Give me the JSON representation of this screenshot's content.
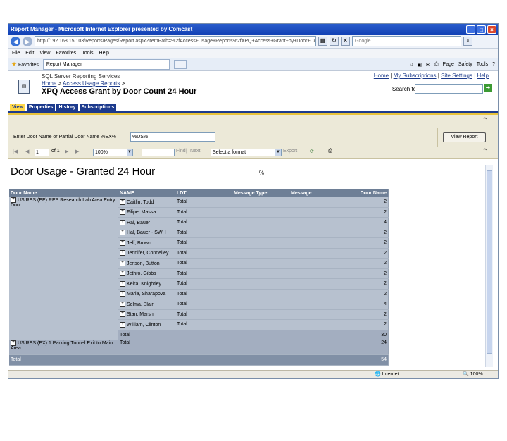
{
  "window": {
    "title": "Report Manager - Microsoft Internet Explorer presented by Comcast",
    "address": "http://192.168.15.103/Reports/Pages/Report.aspx?ItemPath=%2fAccess+Usage+Reports%2fXPQ+Access+Grant+by+Door+Cou",
    "search_placeholder": "Google",
    "menu": [
      "File",
      "Edit",
      "View",
      "Favorites",
      "Tools",
      "Help"
    ],
    "favorites_label": "Favorites",
    "tab_label": "Report Manager",
    "tools": [
      "Page",
      "Safety",
      "Tools"
    ]
  },
  "ssrs": {
    "name": "SQL Server Reporting Services",
    "breadcrumb_home": "Home",
    "breadcrumb_sep": ">",
    "breadcrumb_folder": "Access Usage Reports",
    "title": "XPQ Access Grant by Door Count 24 Hour",
    "links": [
      "Home",
      "My Subscriptions",
      "Site Settings",
      "Help"
    ],
    "search_label": "Search for:"
  },
  "tabs": [
    "View",
    "Properties",
    "History",
    "Subscriptions"
  ],
  "param": {
    "label": "Enter Door Name or Partial Door Name %EX%",
    "value": "%US%",
    "view_report": "View Report"
  },
  "toolbar": {
    "page": "1",
    "of": "of 1",
    "zoom": "100%",
    "find": "Find",
    "next": "Next",
    "format": "Select a format",
    "export": "Export"
  },
  "report": {
    "title": "Door Usage - Granted 24 Hour",
    "param_echo": "%",
    "headers": [
      "Door Name",
      "NAME",
      "LDT",
      "Message Type",
      "Message",
      "Door Name"
    ],
    "group1": {
      "door": "US RES (EE) RES Research Lab Area Entry Door",
      "rows": [
        {
          "name": "Caitlin, Todd",
          "ldt": "Total",
          "count": "2"
        },
        {
          "name": "Filipe, Massa",
          "ldt": "Total",
          "count": "2"
        },
        {
          "name": "Hal, Bauer",
          "ldt": "Total",
          "count": "4"
        },
        {
          "name": "Hal, Bauer - SWH",
          "ldt": "Total",
          "count": "2"
        },
        {
          "name": "Jeff, Brown",
          "ldt": "Total",
          "count": "2"
        },
        {
          "name": "Jennifer, Connelley",
          "ldt": "Total",
          "count": "2"
        },
        {
          "name": "Jenson, Button",
          "ldt": "Total",
          "count": "2"
        },
        {
          "name": "Jethro, Gibbs",
          "ldt": "Total",
          "count": "2"
        },
        {
          "name": "Keira, Knightley",
          "ldt": "Total",
          "count": "2"
        },
        {
          "name": "Maria, Sharapova",
          "ldt": "Total",
          "count": "2"
        },
        {
          "name": "Selma, Blair",
          "ldt": "Total",
          "count": "4"
        },
        {
          "name": "Stan, Marsh",
          "ldt": "Total",
          "count": "2"
        },
        {
          "name": "William, Clinton",
          "ldt": "Total",
          "count": "2"
        }
      ],
      "subtotal_label": "Total",
      "subtotal": "30"
    },
    "group2": {
      "door": "US RES (EX) 1 Parking Tunnel Exit to Main Area",
      "total_label": "Total",
      "total": "24"
    },
    "grand_label": "Total",
    "grand_total": "54"
  },
  "status": {
    "zone": "Internet",
    "zoom": "100%"
  }
}
